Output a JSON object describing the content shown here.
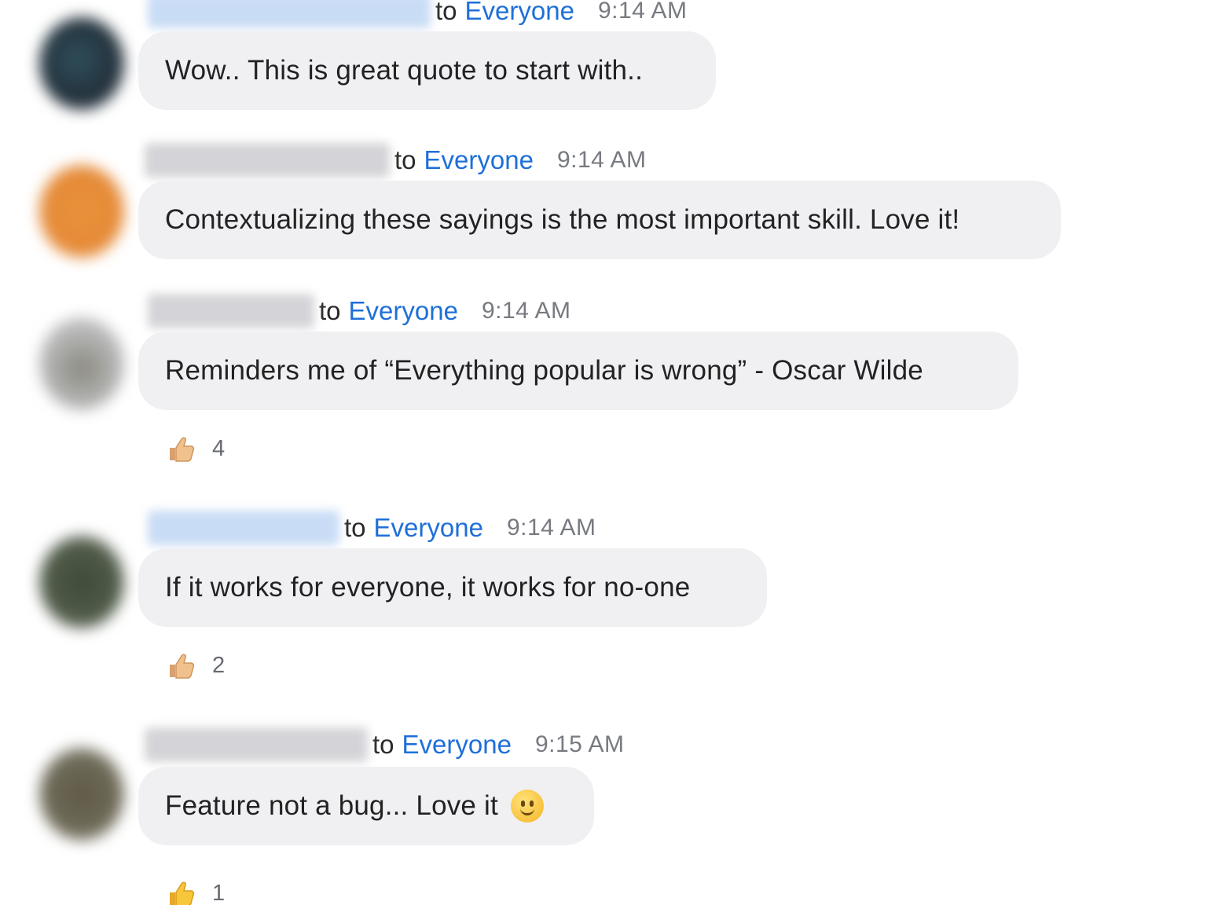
{
  "messages": [
    {
      "recipient_prefix": "to",
      "recipient": "Everyone",
      "time": "9:14 AM",
      "text": "Wow.. This is great quote to start with.."
    },
    {
      "recipient_prefix": "to",
      "recipient": "Everyone",
      "time": "9:14 AM",
      "text": "Contextualizing these sayings is the most important skill. Love it!"
    },
    {
      "recipient_prefix": "to",
      "recipient": "Everyone",
      "time": "9:14 AM",
      "text": "Reminders me of “Everything popular is wrong” - Oscar Wilde",
      "reaction": {
        "icon": "thumbs-up-icon",
        "count": "4"
      }
    },
    {
      "recipient_prefix": "to",
      "recipient": "Everyone",
      "time": "9:14 AM",
      "text": "If it works for everyone, it works for no-one",
      "reaction": {
        "icon": "thumbs-up-icon",
        "count": "2"
      }
    },
    {
      "recipient_prefix": "to",
      "recipient": "Everyone",
      "time": "9:15 AM",
      "text": "Feature not a bug... Love it",
      "emoji": "slightly-smiling-face-icon",
      "reaction": {
        "icon": "thumbs-up-icon",
        "count": "1"
      }
    }
  ],
  "colors": {
    "recipient_link": "#1e6fd9",
    "bubble_bg": "#f0f0f3",
    "timestamp": "#777a80"
  }
}
